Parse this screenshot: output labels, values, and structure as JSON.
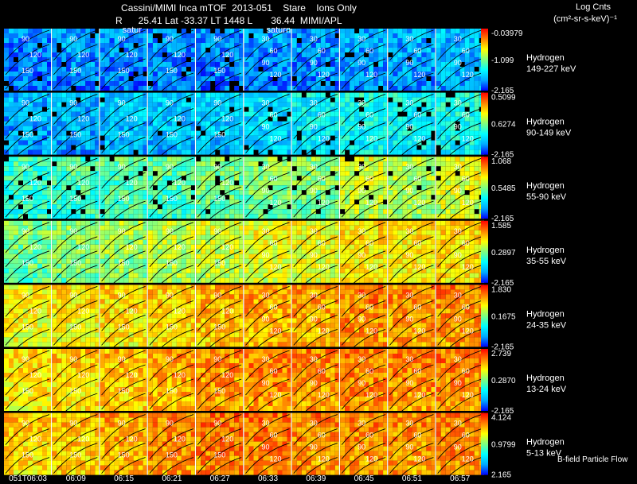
{
  "header": {
    "title": "Cassini/MIMI Inca mTOF  2013-051    Stare    Ions Only",
    "subtitle": "R      25.41 Lat -33.37 LT 1448 L       36.44  MIMI/APL",
    "units_title": "Log Cnts",
    "units": "(cm²-sr-s-keV)⁻¹",
    "footer_note": "B-field Particle Flow"
  },
  "chart_data": {
    "type": "heatmap",
    "description_free": true,
    "time_labels": [
      "051T06:03",
      "06:09",
      "06:15",
      "06:21",
      "06:27",
      "06:33",
      "06:39",
      "06:45",
      "06:51",
      "06:57"
    ],
    "saturn_labels": [
      {
        "col": 2,
        "text": "satur"
      },
      {
        "col": 5,
        "text": "saturn"
      }
    ],
    "colorscale": [
      "#0000ff",
      "#00aaff",
      "#00ffff",
      "#80ff80",
      "#ffff00",
      "#ff8000",
      "#ff0000"
    ],
    "rows": [
      {
        "species": "Hydrogen",
        "energy": "149-227 keV",
        "max": "-0.03979",
        "mid": "-1.099",
        "min": "-2.165",
        "levels": [
          0.15,
          0.18,
          0.16,
          0.17,
          0.16,
          0.17,
          0.17,
          0.2,
          0.2,
          0.22
        ]
      },
      {
        "species": "Hydrogen",
        "energy": "90-149 keV",
        "max": "0.5099",
        "mid": "0.6274",
        "min": "-2.165",
        "levels": [
          0.2,
          0.22,
          0.24,
          0.24,
          0.26,
          0.28,
          0.32,
          0.36,
          0.34,
          0.36
        ]
      },
      {
        "species": "Hydrogen",
        "energy": "55-90 keV",
        "max": "1.068",
        "mid": "0.5485",
        "min": "-2.165",
        "levels": [
          0.42,
          0.44,
          0.46,
          0.46,
          0.5,
          0.52,
          0.52,
          0.62,
          0.58,
          0.64
        ]
      },
      {
        "species": "Hydrogen",
        "energy": "35-55 keV",
        "max": "1.585",
        "mid": "0.2897",
        "min": "-2.165",
        "levels": [
          0.5,
          0.52,
          0.56,
          0.6,
          0.62,
          0.66,
          0.66,
          0.72,
          0.7,
          0.74
        ]
      },
      {
        "species": "Hydrogen",
        "energy": "24-35 keV",
        "max": "1.830",
        "mid": "0.1675",
        "min": "-2.165",
        "levels": [
          0.68,
          0.7,
          0.72,
          0.74,
          0.78,
          0.8,
          0.8,
          0.84,
          0.82,
          0.84
        ]
      },
      {
        "species": "Hydrogen",
        "energy": "13-24 keV",
        "max": "2.739",
        "mid": "0.2870",
        "min": "-2.165",
        "levels": [
          0.72,
          0.74,
          0.76,
          0.8,
          0.82,
          0.84,
          0.83,
          0.85,
          0.84,
          0.85
        ]
      },
      {
        "species": "Hydrogen",
        "energy": "5-13 keV",
        "max": "4.124",
        "mid": "0.9799",
        "min": "2.165",
        "levels": [
          0.74,
          0.76,
          0.8,
          0.84,
          0.86,
          0.86,
          0.84,
          0.84,
          0.83,
          0.84
        ]
      }
    ],
    "contour_labels_left": [
      "90",
      "120",
      "150"
    ],
    "contour_labels_right": [
      "30",
      "60",
      "90",
      "120"
    ]
  }
}
